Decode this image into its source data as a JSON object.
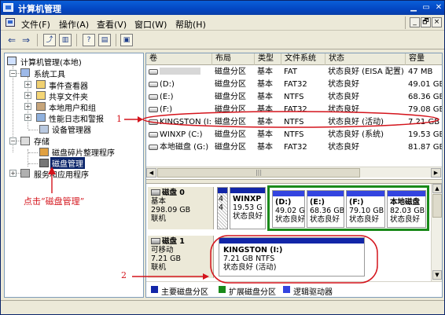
{
  "window": {
    "title": "计算机管理"
  },
  "menu": {
    "items": [
      "文件(F)",
      "操作(A)",
      "查看(V)",
      "窗口(W)",
      "帮助(H)"
    ],
    "mdi_minimize": "_",
    "mdi_restore": "🗗",
    "mdi_close": "×"
  },
  "tree": {
    "root": "计算机管理(本地)",
    "system_tools": "系统工具",
    "event_viewer": "事件查看器",
    "shared_folders": "共享文件夹",
    "local_users": "本地用户和组",
    "perf_logs": "性能日志和警报",
    "device_manager": "设备管理器",
    "storage": "存储",
    "defrag": "磁盘碎片整理程序",
    "disk_mgmt": "磁盘管理",
    "services": "服务和应用程序"
  },
  "volumes": {
    "columns": [
      "卷",
      "布局",
      "类型",
      "文件系统",
      "状态",
      "容量"
    ],
    "rows": [
      {
        "vol": "",
        "layout": "磁盘分区",
        "type": "基本",
        "fs": "FAT",
        "status": "状态良好 (EISA 配置)",
        "cap": "47 MB"
      },
      {
        "vol": "(D:)",
        "layout": "磁盘分区",
        "type": "基本",
        "fs": "FAT32",
        "status": "状态良好",
        "cap": "49.01 GB"
      },
      {
        "vol": "(E:)",
        "layout": "磁盘分区",
        "type": "基本",
        "fs": "NTFS",
        "status": "状态良好",
        "cap": "68.36 GB"
      },
      {
        "vol": "(F:)",
        "layout": "磁盘分区",
        "type": "基本",
        "fs": "FAT32",
        "status": "状态良好",
        "cap": "79.08 GB"
      },
      {
        "vol": "KINGSTON (I:)",
        "layout": "磁盘分区",
        "type": "基本",
        "fs": "NTFS",
        "status": "状态良好 (活动)",
        "cap": "7.21 GB"
      },
      {
        "vol": "WINXP (C:)",
        "layout": "磁盘分区",
        "type": "基本",
        "fs": "NTFS",
        "status": "状态良好 (系统)",
        "cap": "19.53 GB"
      },
      {
        "vol": "本地磁盘 (G:)",
        "layout": "磁盘分区",
        "type": "基本",
        "fs": "FAT32",
        "status": "状态良好",
        "cap": "81.87 GB"
      }
    ]
  },
  "disk0": {
    "name": "磁盘 0",
    "type": "基本",
    "size": "298.09 GB",
    "status": "联机",
    "partitions": [
      {
        "name": "",
        "size": "4",
        "status": "4"
      },
      {
        "name": "WINXP",
        "size": "19.53 G",
        "status": "状态良好"
      },
      {
        "name": "(D:)",
        "size": "49.02 G",
        "status": "状态良好"
      },
      {
        "name": "(E:)",
        "size": "68.36 GB",
        "status": "状态良好"
      },
      {
        "name": "(F:)",
        "size": "79.10 GB",
        "status": "状态良好"
      },
      {
        "name": "本地磁盘",
        "size": "82.03 GB",
        "status": "状态良好"
      }
    ]
  },
  "disk1": {
    "name": "磁盘 1",
    "type": "可移动",
    "size": "7.21 GB",
    "status": "联机",
    "partition": {
      "name": "KINGSTON (I:)",
      "size": "7.21 GB NTFS",
      "status": "状态良好 (活动)"
    }
  },
  "legend": [
    {
      "label": "主要磁盘分区",
      "color": "#1226a8"
    },
    {
      "label": "扩展磁盘分区",
      "color": "#1a8a1a"
    },
    {
      "label": "逻辑驱动器",
      "color": "#3344e0"
    }
  ],
  "annotations": {
    "click_label": "点击“磁盘管理”",
    "marker1": "1",
    "marker2": "2"
  },
  "colors": {
    "annotation": "#d4141c",
    "title_bar": "#0a5fd8",
    "selection": "#0a246a"
  }
}
